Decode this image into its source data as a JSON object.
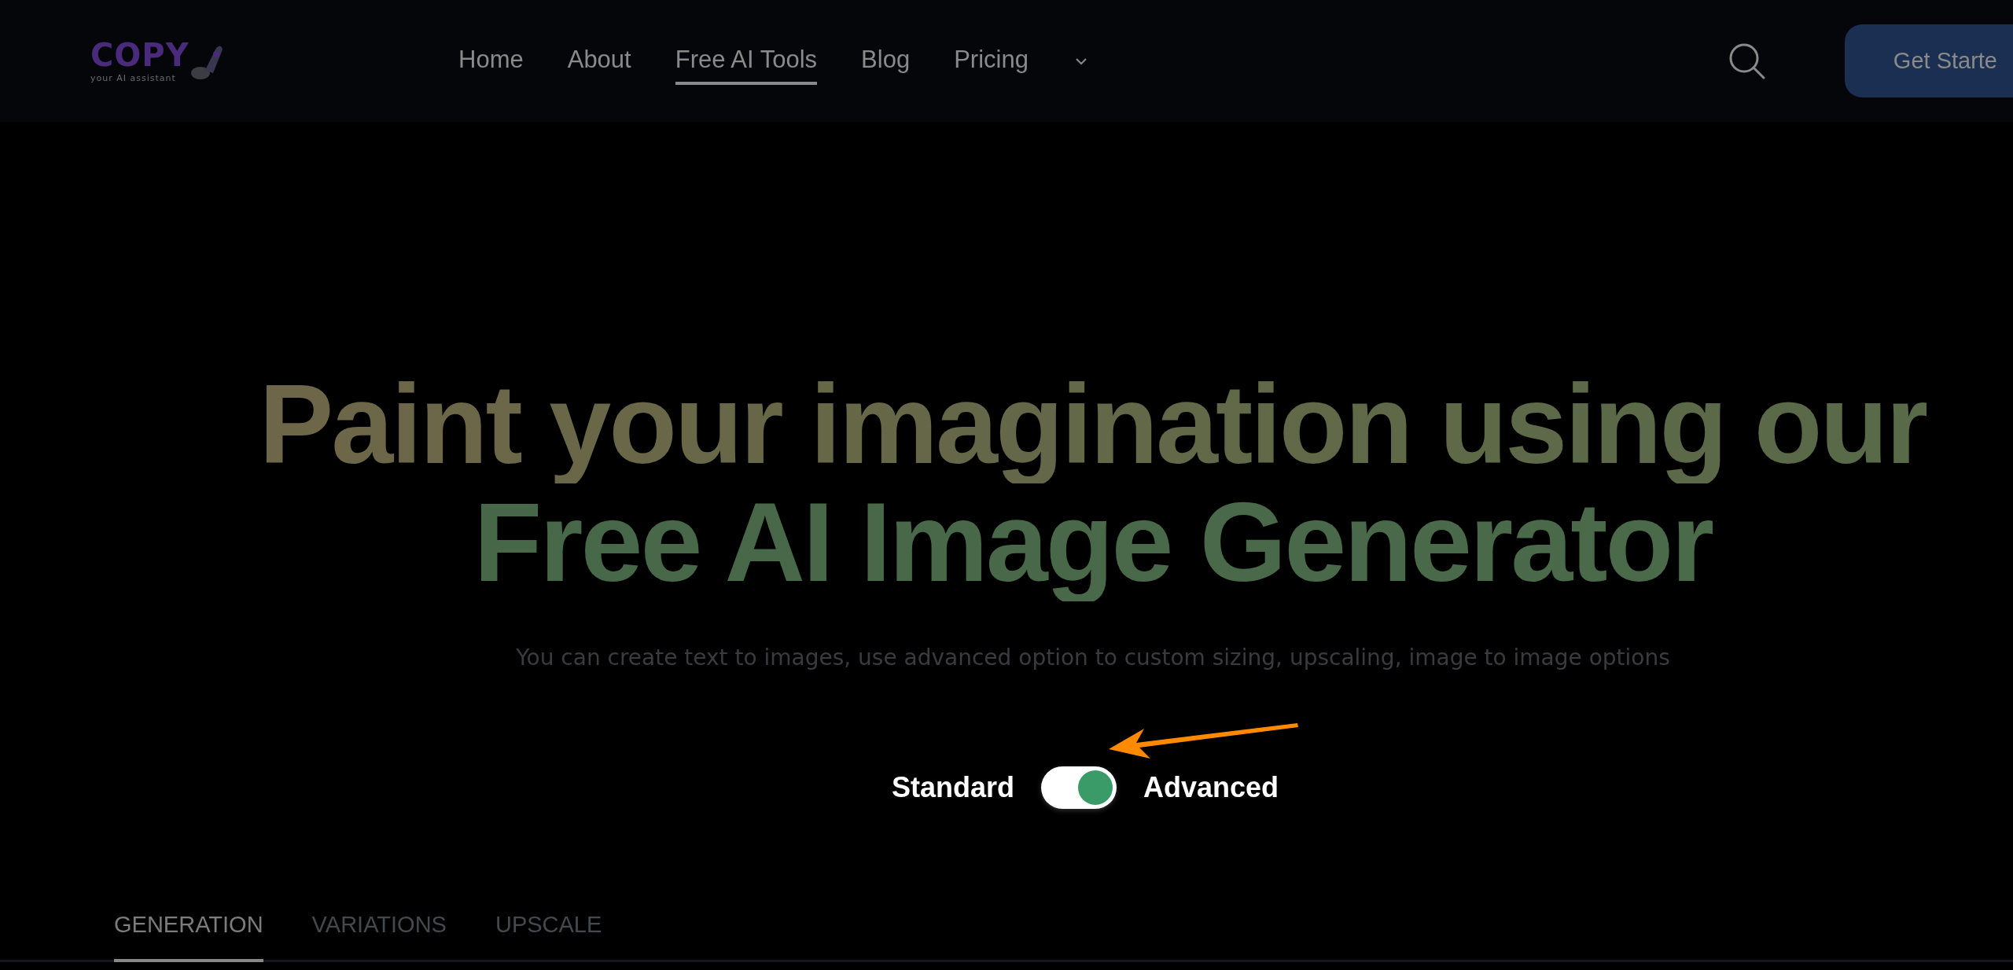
{
  "logo": {
    "text": "COPY",
    "tagline": "your AI assistant"
  },
  "nav": {
    "items": [
      {
        "label": "Home",
        "selected": false
      },
      {
        "label": "About",
        "selected": false
      },
      {
        "label": "Free AI Tools",
        "selected": true
      },
      {
        "label": "Blog",
        "selected": false
      },
      {
        "label": "Pricing",
        "selected": false
      }
    ],
    "more_menu": {
      "expanded": false
    }
  },
  "cta": {
    "label": "Get Starte"
  },
  "hero": {
    "title_lines": [
      "Paint your imagination using our",
      "Free AI Image Generator"
    ],
    "subtitle": "You can create text to images, use advanced option to custom sizing, upscaling, image to image options"
  },
  "mode_toggle": {
    "left_label": "Standard",
    "right_label": "Advanced",
    "on": true
  },
  "tabs": [
    {
      "label": "GENERATION",
      "selected": true
    },
    {
      "label": "VARIATIONS",
      "selected": false
    },
    {
      "label": "UPSCALE",
      "selected": false
    }
  ]
}
